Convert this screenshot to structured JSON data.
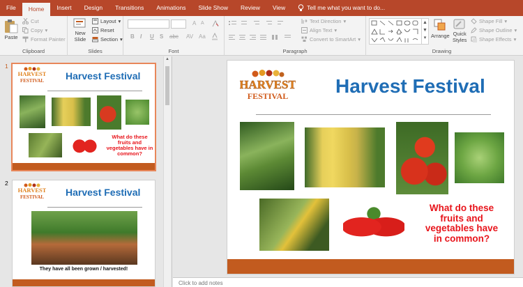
{
  "tabs": [
    "File",
    "Home",
    "Insert",
    "Design",
    "Transitions",
    "Animations",
    "Slide Show",
    "Review",
    "View"
  ],
  "tell_me": "Tell me what you want to do...",
  "ribbon": {
    "clipboard": {
      "paste": "Paste",
      "cut": "Cut",
      "copy": "Copy",
      "format_painter": "Format Painter",
      "label": "Clipboard"
    },
    "slides": {
      "new_slide_line1": "New",
      "new_slide_line2": "Slide",
      "layout": "Layout",
      "reset": "Reset",
      "section": "Section",
      "label": "Slides"
    },
    "font": {
      "label": "Font",
      "bold": "B",
      "italic": "I",
      "underline": "U",
      "strike": "S",
      "size_up": "A",
      "size_down": "A"
    },
    "paragraph": {
      "text_direction": "Text Direction",
      "align_text": "Align Text",
      "convert_smartart": "Convert to SmartArt",
      "label": "Paragraph"
    },
    "drawing": {
      "arrange": "Arrange",
      "quick_styles_1": "Quick",
      "quick_styles_2": "Styles",
      "shape_fill": "Shape Fill",
      "shape_outline": "Shape Outline",
      "shape_effects": "Shape Effects",
      "label": "Drawing"
    }
  },
  "slides": [
    {
      "number": "1",
      "title": "Harvest Festival",
      "question": "What do these fruits and vegetables have in common?"
    },
    {
      "number": "2",
      "title": "Harvest Festival",
      "caption": "They have all been grown / harvested!"
    }
  ],
  "main_slide": {
    "logo_line1": "HARVEST",
    "logo_line2": "FESTIVAL",
    "title": "Harvest Festival",
    "question_line1": "What do these",
    "question_line2": "fruits and",
    "question_line3": "vegetables have",
    "question_line4": "in common?"
  },
  "notes_placeholder": "Click to add notes",
  "colors": {
    "accent": "#b7472a",
    "title_blue": "#1f6db5",
    "question_red": "#e8141b",
    "footer_orange": "#c25b1f"
  }
}
